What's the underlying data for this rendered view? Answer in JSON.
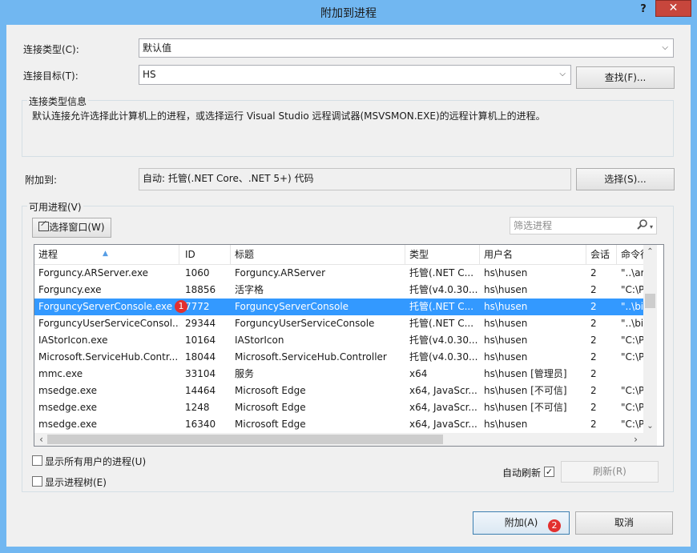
{
  "window": {
    "title": "附加到进程",
    "help": "?",
    "close": "✕"
  },
  "connection": {
    "type_label": "连接类型(C):",
    "type_value": "默认值",
    "target_label": "连接目标(T):",
    "target_value": "HS",
    "find_button": "查找(F)..."
  },
  "info": {
    "title": "连接类型信息",
    "text": "默认连接允许选择此计算机上的进程，或选择运行 Visual Studio 远程调试器(MSVSMON.EXE)的远程计算机上的进程。"
  },
  "attach_to": {
    "label": "附加到:",
    "value": "自动: 托管(.NET Core、.NET 5+) 代码",
    "select_button": "选择(S)..."
  },
  "processes": {
    "group_title": "可用进程(V)",
    "select_window_button": "选择窗口(W)",
    "filter_placeholder": "筛选进程",
    "columns": [
      "进程",
      "ID",
      "标题",
      "类型",
      "用户名",
      "会话",
      "命令行"
    ],
    "rows": [
      [
        "Forguncy.ARServer.exe",
        "1060",
        "Forguncy.ARServer",
        "托管(.NET C...",
        "hs\\husen",
        "2",
        "\"..\\ar"
      ],
      [
        "Forguncy.exe",
        "18856",
        "活字格",
        "托管(v4.0.30...",
        "hs\\husen",
        "2",
        "\"C:\\P"
      ],
      [
        "ForguncyServerConsole.exe",
        "7772",
        "ForguncyServerConsole",
        "托管(.NET C...",
        "hs\\husen",
        "2",
        "\"..\\bi"
      ],
      [
        "ForguncyUserServiceConsol...",
        "29344",
        "ForguncyUserServiceConsole",
        "托管(.NET C...",
        "hs\\husen",
        "2",
        "\"..\\bi"
      ],
      [
        "IAStorIcon.exe",
        "10164",
        "IAStorIcon",
        "托管(v4.0.30...",
        "hs\\husen",
        "2",
        "\"C:\\P"
      ],
      [
        "Microsoft.ServiceHub.Contr...",
        "18044",
        "Microsoft.ServiceHub.Controller",
        "托管(v4.0.30...",
        "hs\\husen",
        "2",
        "\"C:\\P"
      ],
      [
        "mmc.exe",
        "33104",
        "服务",
        "x64",
        "hs\\husen [管理员]",
        "2",
        ""
      ],
      [
        "msedge.exe",
        "14464",
        "Microsoft Edge",
        "x64, JavaScr...",
        "hs\\husen [不可信]",
        "2",
        "\"C:\\P"
      ],
      [
        "msedge.exe",
        "1248",
        "Microsoft Edge",
        "x64, JavaScr...",
        "hs\\husen [不可信]",
        "2",
        "\"C:\\P"
      ],
      [
        "msedge.exe",
        "16340",
        "Microsoft Edge",
        "x64, JavaScr...",
        "hs\\husen",
        "2",
        "\"C:\\P"
      ]
    ],
    "selected_row": 2,
    "show_all_users": "显示所有用户的进程(U)",
    "show_tree": "显示进程树(E)",
    "auto_refresh": "自动刷新",
    "auto_refresh_checked": true,
    "refresh_button": "刷新(R)"
  },
  "badges": {
    "one": "1",
    "two": "2"
  },
  "footer": {
    "attach_button": "附加(A)",
    "cancel_button": "取消"
  },
  "colors": {
    "title_bar": "#71b7f1",
    "selection": "#3399ff",
    "close": "#c7463c",
    "badge": "#e3302f"
  },
  "icons": {
    "filter": "search-icon",
    "select_window": "crosshair-window-icon"
  }
}
